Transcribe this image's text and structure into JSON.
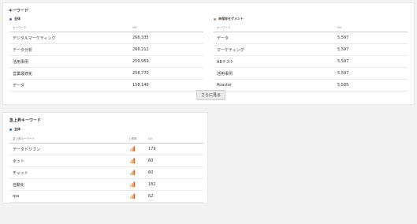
{
  "keywords_panel": {
    "title": "キーワード",
    "left": {
      "legend": "全体",
      "legend_color": "#2f6fb3",
      "col_keyword": "キーワード",
      "col_uu": "UU",
      "rows": [
        {
          "keyword": "デジタルマーケティング",
          "uu": "266,335"
        },
        {
          "keyword": "データ分析",
          "uu": "266,212"
        },
        {
          "keyword": "活用事例",
          "uu": "259,959"
        },
        {
          "keyword": "営業最適化",
          "uu": "258,770"
        },
        {
          "keyword": "データ",
          "uu": "158,146"
        }
      ]
    },
    "right": {
      "legend": "未保存セグメント",
      "legend_color": "#e9822e",
      "col_keyword": "キーワード",
      "col_uu": "UU",
      "rows": [
        {
          "keyword": "データ",
          "uu": "5,597"
        },
        {
          "keyword": "マーケティング",
          "uu": "5,597"
        },
        {
          "keyword": "ABテスト",
          "uu": "5,597"
        },
        {
          "keyword": "活用事例",
          "uu": "5,597"
        },
        {
          "keyword": "Roaster",
          "uu": "5,585"
        }
      ]
    },
    "more_button": "さらに見る"
  },
  "rising_panel": {
    "title": "急上昇キーワード",
    "legend": "全体",
    "legend_color": "#2f6fb3",
    "col_keyword": "急上昇キーワード",
    "col_trend": "上昇率",
    "col_uu": "UU",
    "trend_icon": "rising-bars-icon",
    "trend_colors": [
      "#f5c06b",
      "#ef9a3c",
      "#e2562c"
    ],
    "rows": [
      {
        "keyword": "データドリブン",
        "uu": "179"
      },
      {
        "keyword": "ボット",
        "uu": "60"
      },
      {
        "keyword": "チャット",
        "uu": "60"
      },
      {
        "keyword": "自動化",
        "uu": "182"
      },
      {
        "keyword": "rpa",
        "uu": "62"
      }
    ]
  }
}
